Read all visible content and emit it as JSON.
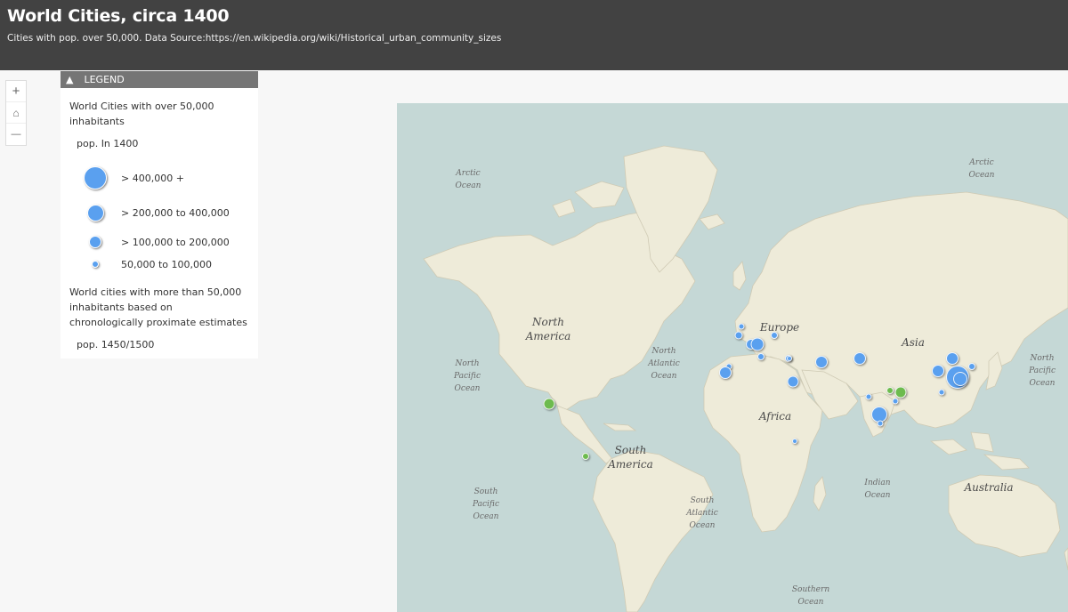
{
  "header": {
    "title": "World Cities, circa 1400",
    "subtitle": "Cities with pop. over 50,000. Data Source:https://en.wikipedia.org/wiki/Historical_urban_community_sizes"
  },
  "zoom": {
    "in": "+",
    "home": "⌂",
    "out": "—"
  },
  "legend": {
    "header": "LEGEND",
    "section1": "World Cities with over 50,000 inhabitants",
    "field1": "pop. In 1400",
    "classes": [
      {
        "label": "> 400,000 +"
      },
      {
        "label": "> 200,000 to 400,000"
      },
      {
        "label": "> 100,000 to 200,000"
      },
      {
        "label": "50,000 to 100,000"
      }
    ],
    "section2": "World cities with more than 50,000 inhabitants based on chronologically proximate estimates",
    "field2": "pop. 1450/1500"
  },
  "colors": {
    "blue_marker": "#5aa0ef",
    "green_marker": "#6dbb4e",
    "ocean": "#c5d8d6",
    "land": "#eeebd9"
  },
  "map_labels": {
    "arctic_ocean": "Arctic Ocean",
    "north_america": "North America",
    "europe": "Europe",
    "asia": "Asia",
    "north_pacific": "North Pacific Ocean",
    "north_atlantic": "North Atlantic Ocean",
    "africa": "Africa",
    "south_america": "South America",
    "south_pacific": "South Pacific Ocean",
    "south_atlantic": "South Atlantic Ocean",
    "indian_ocean": "Indian Ocean",
    "australia": "Australia",
    "southern_ocean": "Southern Ocean"
  }
}
